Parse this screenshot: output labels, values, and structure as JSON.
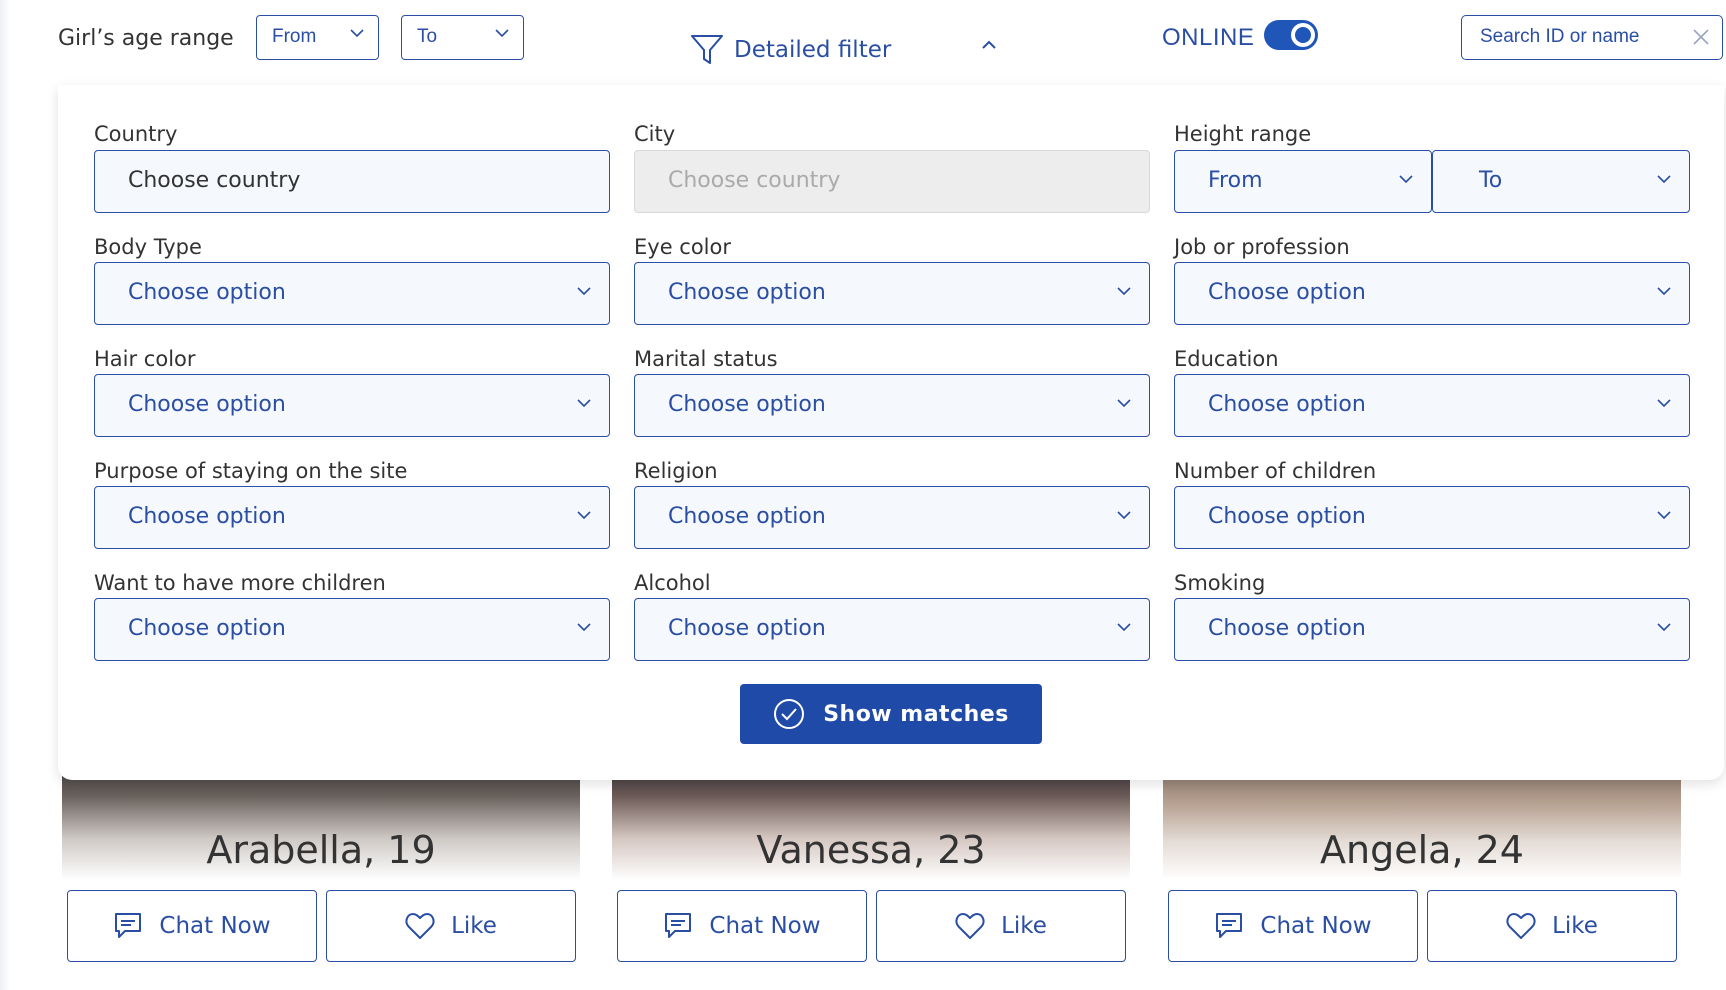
{
  "header": {
    "age_label": "Girl’s age range",
    "age_from": "From",
    "age_to": "To",
    "detailed_filter": "Detailed filter",
    "online_label": "ONLINE",
    "online_on": true,
    "search_placeholder": "Search ID or name"
  },
  "filters": {
    "country": {
      "label": "Country",
      "value": "Choose country"
    },
    "city": {
      "label": "City",
      "value": "Choose country"
    },
    "height": {
      "label": "Height range",
      "from": "From",
      "to": "To"
    },
    "body_type": {
      "label": "Body Type",
      "value": "Choose option"
    },
    "eye_color": {
      "label": "Eye color",
      "value": "Choose option"
    },
    "job": {
      "label": "Job or profession",
      "value": "Choose option"
    },
    "hair_color": {
      "label": "Hair color",
      "value": "Choose option"
    },
    "marital_status": {
      "label": "Marital status",
      "value": "Choose option"
    },
    "education": {
      "label": "Education",
      "value": "Choose option"
    },
    "purpose": {
      "label": "Purpose of staying on the site",
      "value": "Choose option"
    },
    "religion": {
      "label": "Religion",
      "value": "Choose option"
    },
    "children": {
      "label": "Number of children",
      "value": "Choose option"
    },
    "more_children": {
      "label": "Want to have more children",
      "value": "Choose option"
    },
    "alcohol": {
      "label": "Alcohol",
      "value": "Choose option"
    },
    "smoking": {
      "label": "Smoking",
      "value": "Choose option"
    },
    "show_matches": "Show matches"
  },
  "profiles": [
    {
      "name": "Arabella, 19",
      "chat": "Chat Now",
      "like": "Like"
    },
    {
      "name": "Vanessa, 23",
      "chat": "Chat Now",
      "like": "Like"
    },
    {
      "name": "Angela, 24",
      "chat": "Chat Now",
      "like": "Like"
    }
  ],
  "colors": {
    "accent": "#2a4ea3",
    "button_bg": "#1f4aa8",
    "disabled_bg": "#ededed"
  }
}
